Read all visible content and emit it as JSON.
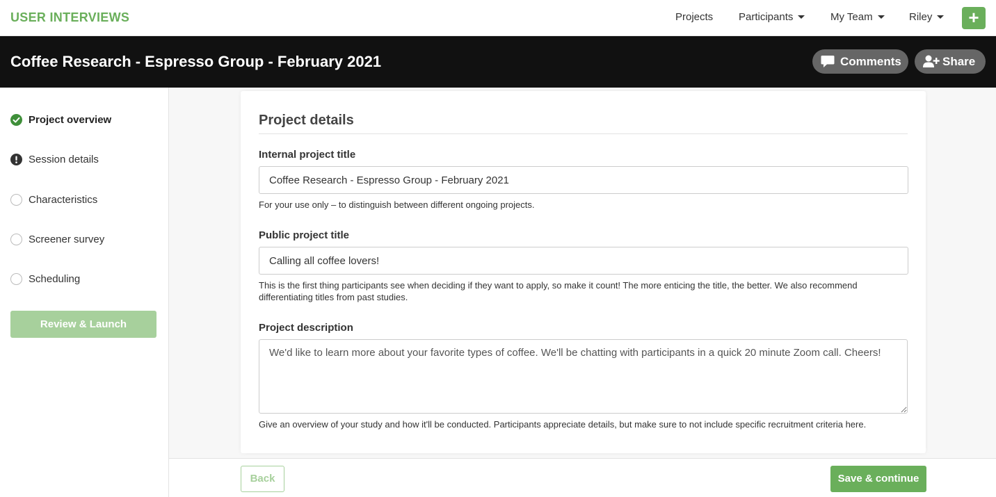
{
  "brand": "USER INTERVIEWS",
  "nav": {
    "projects": "Projects",
    "participants": "Participants",
    "my_team": "My Team",
    "user": "Riley",
    "add_icon": "plus-icon"
  },
  "header": {
    "title": "Coffee Research - Espresso Group - February 2021",
    "comments_label": "Comments",
    "share_label": "Share"
  },
  "sidebar": {
    "steps": [
      {
        "label": "Project overview",
        "status": "complete",
        "icon": "check-circle-icon"
      },
      {
        "label": "Session details",
        "status": "warning",
        "icon": "exclamation-circle-icon"
      },
      {
        "label": "Characteristics",
        "status": "incomplete",
        "icon": "empty-circle-icon"
      },
      {
        "label": "Screener survey",
        "status": "incomplete",
        "icon": "empty-circle-icon"
      },
      {
        "label": "Scheduling",
        "status": "incomplete",
        "icon": "empty-circle-icon"
      }
    ],
    "review_label": "Review & Launch"
  },
  "form": {
    "heading": "Project details",
    "internal": {
      "label": "Internal project title",
      "value": "Coffee Research - Espresso Group - February 2021",
      "help": "For your use only – to distinguish between different ongoing projects."
    },
    "public": {
      "label": "Public project title",
      "value": "Calling all coffee lovers!",
      "help": "This is the first thing participants see when deciding if they want to apply, so make it count! The more enticing the title, the better. We also recommend differentiating titles from past studies."
    },
    "description": {
      "label": "Project description",
      "value": "We'd like to learn more about your favorite types of coffee. We'll be chatting with participants in a quick 20 minute Zoom call. Cheers!",
      "help": "Give an overview of your study and how it'll be conducted. Participants appreciate details, but make sure to not include specific recruitment criteria here."
    }
  },
  "footer": {
    "back_label": "Back",
    "save_label": "Save & continue"
  },
  "colors": {
    "brand_green": "#6aaf5b",
    "light_green": "#a7d09c",
    "header_bg": "#111111",
    "pill_bg": "#666666"
  }
}
